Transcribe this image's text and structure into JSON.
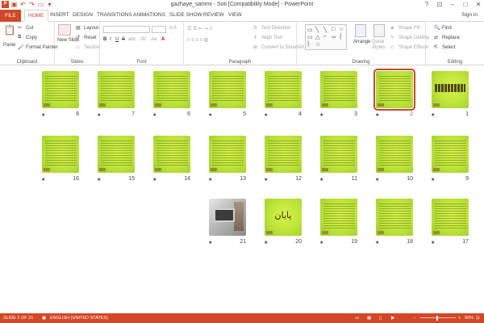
{
  "app": {
    "title": "gazhaye_sammi - Soti [Compatibility Mode] - PowerPoint",
    "sign_in": "Sign in",
    "logo_label": "P"
  },
  "tabs": {
    "file": "FILE",
    "items": [
      "HOME",
      "INSERT",
      "DESIGN",
      "TRANSITIONS",
      "ANIMATIONS",
      "SLIDE SHOW",
      "REVIEW",
      "VIEW"
    ],
    "active": "HOME"
  },
  "ribbon": {
    "clipboard": {
      "label": "Clipboard",
      "paste": "Paste",
      "cut": "Cut",
      "copy": "Copy",
      "format_painter": "Format Painter"
    },
    "slides": {
      "label": "Slides",
      "new_slide": "New Slide",
      "layout": "Layout",
      "reset": "Reset",
      "section": "Section"
    },
    "font": {
      "label": "Font",
      "bold": "B",
      "italic": "I",
      "underline": "U",
      "strike": "S",
      "shadow": "abc",
      "spacing": "AV",
      "case": "Aa"
    },
    "paragraph": {
      "label": "Paragraph",
      "text_direction": "Text Direction",
      "align_text": "Align Text",
      "smartart": "Convert to SmartArt"
    },
    "drawing": {
      "label": "Drawing",
      "arrange": "Arrange",
      "quick_styles": "Quick Styles",
      "shape_fill": "Shape Fill",
      "shape_outline": "Shape Outline",
      "shape_effects": "Shape Effects"
    },
    "editing": {
      "label": "Editing",
      "find": "Find",
      "replace": "Replace",
      "select": "Select"
    }
  },
  "slides": [
    {
      "num": "1",
      "kind": "title"
    },
    {
      "num": "2",
      "kind": "text",
      "selected": true
    },
    {
      "num": "3",
      "kind": "text"
    },
    {
      "num": "4",
      "kind": "text"
    },
    {
      "num": "5",
      "kind": "text"
    },
    {
      "num": "6",
      "kind": "text"
    },
    {
      "num": "7",
      "kind": "text"
    },
    {
      "num": "8",
      "kind": "text"
    },
    {
      "num": "9",
      "kind": "text"
    },
    {
      "num": "10",
      "kind": "text"
    },
    {
      "num": "11",
      "kind": "text"
    },
    {
      "num": "12",
      "kind": "text"
    },
    {
      "num": "13",
      "kind": "text"
    },
    {
      "num": "14",
      "kind": "text"
    },
    {
      "num": "15",
      "kind": "text"
    },
    {
      "num": "16",
      "kind": "text"
    },
    {
      "num": "17",
      "kind": "text"
    },
    {
      "num": "18",
      "kind": "text"
    },
    {
      "num": "19",
      "kind": "text"
    },
    {
      "num": "20",
      "kind": "end",
      "label": "پایان"
    },
    {
      "num": "21",
      "kind": "photo"
    }
  ],
  "status": {
    "slide_info": "SLIDE 2 OF 21",
    "language": "ENGLISH (UNITED STATES)",
    "zoom": "50%",
    "zoom_out": "−",
    "zoom_in": "+"
  }
}
